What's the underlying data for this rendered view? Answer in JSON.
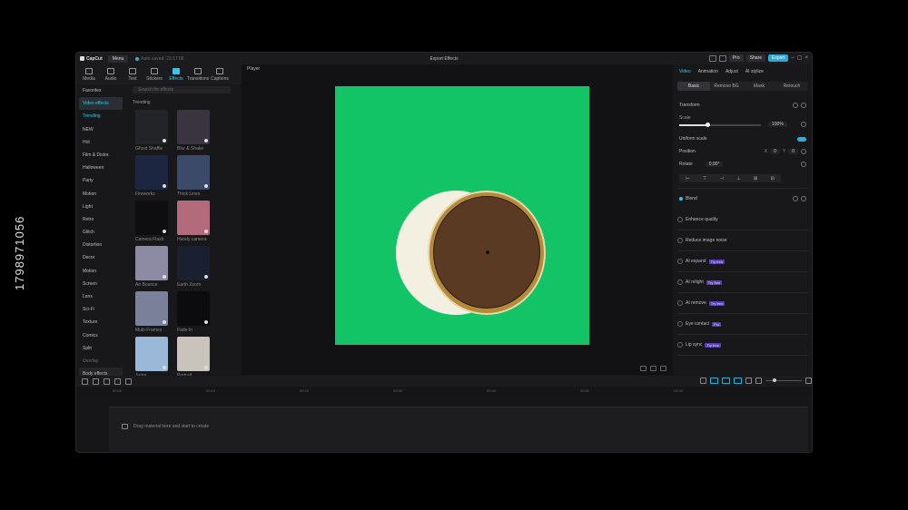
{
  "titlebar": {
    "logo": "CapCut",
    "menu": "Menu",
    "autosave": "Auto saved: 23:17:06",
    "project_title": "Export Effects",
    "pro_label": "Pro",
    "share_label": "Share",
    "export_label": "Export"
  },
  "tools": [
    {
      "label": "Media",
      "icon": "media-icon"
    },
    {
      "label": "Audio",
      "icon": "audio-icon"
    },
    {
      "label": "Text",
      "icon": "text-icon"
    },
    {
      "label": "Stickers",
      "icon": "stickers-icon"
    },
    {
      "label": "Effects",
      "icon": "effects-icon"
    },
    {
      "label": "Transitions",
      "icon": "transitions-icon"
    },
    {
      "label": "Captions",
      "icon": "captions-icon"
    }
  ],
  "categories": [
    {
      "label": "Favorites",
      "state": "normal"
    },
    {
      "label": "Video effects",
      "state": "selected"
    },
    {
      "label": "Trending",
      "state": "highlight"
    },
    {
      "label": "NEW",
      "state": "normal"
    },
    {
      "label": "Hot",
      "state": "normal"
    },
    {
      "label": "Film & Distor.",
      "state": "normal"
    },
    {
      "label": "Halloween",
      "state": "normal"
    },
    {
      "label": "Party",
      "state": "normal"
    },
    {
      "label": "Motion",
      "state": "normal"
    },
    {
      "label": "Light",
      "state": "normal"
    },
    {
      "label": "Retro",
      "state": "normal"
    },
    {
      "label": "Glitch",
      "state": "normal"
    },
    {
      "label": "Distortion",
      "state": "normal"
    },
    {
      "label": "Decor",
      "state": "normal"
    },
    {
      "label": "Motion",
      "state": "normal"
    },
    {
      "label": "Screen",
      "state": "normal"
    },
    {
      "label": "Lens",
      "state": "normal"
    },
    {
      "label": "Sci-Fi",
      "state": "normal"
    },
    {
      "label": "Texture",
      "state": "normal"
    },
    {
      "label": "Comics",
      "state": "normal"
    },
    {
      "label": "Split",
      "state": "normal"
    },
    {
      "label": "Overlay",
      "state": "sub"
    },
    {
      "label": "Body effects",
      "state": "bodyfx"
    }
  ],
  "effects_panel": {
    "search_placeholder": "Search for effects",
    "section_title": "Trending",
    "items": [
      {
        "label": "Ghost Shaffle",
        "color": "#222428"
      },
      {
        "label": "Blur & Shake",
        "color": "#3a3440"
      },
      {
        "label": "Fireworks",
        "color": "#1c2640"
      },
      {
        "label": "Thick Lines",
        "color": "#3a4a68"
      },
      {
        "label": "Camera Flash",
        "color": "#0e0e10"
      },
      {
        "label": "Handy camera",
        "color": "#b36a7a"
      },
      {
        "label": "Air Bounce",
        "color": "#8d8aa4"
      },
      {
        "label": "Earth Zoom",
        "color": "#1a2030"
      },
      {
        "label": "Multi-Frames",
        "color": "#7a7f9a"
      },
      {
        "label": "Fade In",
        "color": "#0c0c0e"
      },
      {
        "label": "Jump",
        "color": "#9ab8d8"
      },
      {
        "label": "Portrait",
        "color": "#c8c4bc"
      }
    ]
  },
  "player": {
    "label": "Player",
    "bg_color": "#12c466"
  },
  "right_panel": {
    "tabs": [
      "Video",
      "Animation",
      "Adjust",
      "AI stylize"
    ],
    "subtabs": [
      "Basic",
      "Remove BG",
      "Mask",
      "Retouch"
    ],
    "transform_label": "Transform",
    "scale_label": "Scale",
    "scale_value": "100%",
    "scale_fraction": 0.34,
    "uniform_label": "Uniform scale",
    "position_label": "Position",
    "position_x_axis": "X",
    "position_x": "0",
    "position_y_axis": "Y",
    "position_y": "0",
    "rotate_label": "Rotate",
    "rotate_value": "0.00°",
    "blend_label": "Blend",
    "features": [
      {
        "label": "Enhance quality",
        "badge": ""
      },
      {
        "label": "Reduce image noise",
        "badge": ""
      },
      {
        "label": "AI expand",
        "badge": "Try free"
      },
      {
        "label": "AI relight",
        "badge": "Try free"
      },
      {
        "label": "AI remove",
        "badge": "Try free"
      },
      {
        "label": "Eye contact",
        "badge": "Pro"
      },
      {
        "label": "Lip sync",
        "badge": "Try free"
      }
    ]
  },
  "timeline": {
    "ruler": [
      "00:00",
      "00:10",
      "00:20",
      "00:30",
      "00:40",
      "00:50",
      "01:00"
    ],
    "hint": "Drag material here and start to create"
  },
  "stock_id": "1798971056"
}
